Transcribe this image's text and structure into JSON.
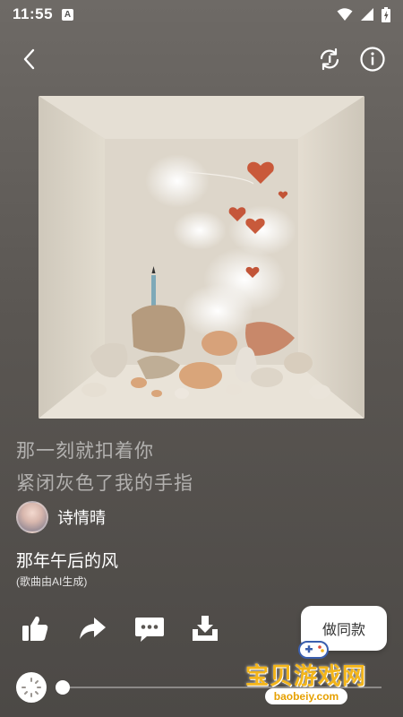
{
  "status_bar": {
    "time": "11:55",
    "notification_badge": "A"
  },
  "header": {
    "back_icon": "back-arrow-icon",
    "refresh_icon": "refresh-icon",
    "info_icon": "info-icon"
  },
  "lyrics": [
    "那一刻就扣着你",
    "紧闭灰色了我的手指"
  ],
  "artist": {
    "name": "诗情晴"
  },
  "song": {
    "title": "那年午后的风",
    "note": "(歌曲由AI生成)"
  },
  "actions": {
    "like_icon": "thumbs-up-icon",
    "share_icon": "share-arrow-icon",
    "comment_icon": "comment-icon",
    "download_icon": "download-icon",
    "make_same_label": "做同款"
  },
  "watermark": {
    "text": "宝贝游戏网",
    "url": "baobeiy.com"
  },
  "player": {
    "progress": 0.0
  },
  "colors": {
    "accent": "#f3b51a",
    "background": "#5a5652"
  }
}
